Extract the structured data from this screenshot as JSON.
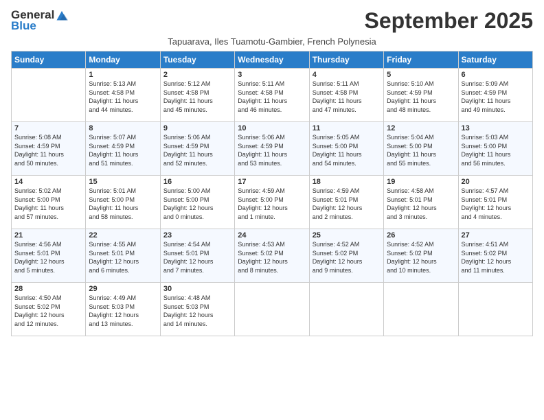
{
  "logo": {
    "general": "General",
    "blue": "Blue"
  },
  "header": {
    "month_title": "September 2025",
    "subtitle": "Tapuarava, Iles Tuamotu-Gambier, French Polynesia"
  },
  "days_of_week": [
    "Sunday",
    "Monday",
    "Tuesday",
    "Wednesday",
    "Thursday",
    "Friday",
    "Saturday"
  ],
  "weeks": [
    [
      {
        "day": "",
        "content": ""
      },
      {
        "day": "1",
        "content": "Sunrise: 5:13 AM\nSunset: 4:58 PM\nDaylight: 11 hours\nand 44 minutes."
      },
      {
        "day": "2",
        "content": "Sunrise: 5:12 AM\nSunset: 4:58 PM\nDaylight: 11 hours\nand 45 minutes."
      },
      {
        "day": "3",
        "content": "Sunrise: 5:11 AM\nSunset: 4:58 PM\nDaylight: 11 hours\nand 46 minutes."
      },
      {
        "day": "4",
        "content": "Sunrise: 5:11 AM\nSunset: 4:58 PM\nDaylight: 11 hours\nand 47 minutes."
      },
      {
        "day": "5",
        "content": "Sunrise: 5:10 AM\nSunset: 4:59 PM\nDaylight: 11 hours\nand 48 minutes."
      },
      {
        "day": "6",
        "content": "Sunrise: 5:09 AM\nSunset: 4:59 PM\nDaylight: 11 hours\nand 49 minutes."
      }
    ],
    [
      {
        "day": "7",
        "content": "Sunrise: 5:08 AM\nSunset: 4:59 PM\nDaylight: 11 hours\nand 50 minutes."
      },
      {
        "day": "8",
        "content": "Sunrise: 5:07 AM\nSunset: 4:59 PM\nDaylight: 11 hours\nand 51 minutes."
      },
      {
        "day": "9",
        "content": "Sunrise: 5:06 AM\nSunset: 4:59 PM\nDaylight: 11 hours\nand 52 minutes."
      },
      {
        "day": "10",
        "content": "Sunrise: 5:06 AM\nSunset: 4:59 PM\nDaylight: 11 hours\nand 53 minutes."
      },
      {
        "day": "11",
        "content": "Sunrise: 5:05 AM\nSunset: 5:00 PM\nDaylight: 11 hours\nand 54 minutes."
      },
      {
        "day": "12",
        "content": "Sunrise: 5:04 AM\nSunset: 5:00 PM\nDaylight: 11 hours\nand 55 minutes."
      },
      {
        "day": "13",
        "content": "Sunrise: 5:03 AM\nSunset: 5:00 PM\nDaylight: 11 hours\nand 56 minutes."
      }
    ],
    [
      {
        "day": "14",
        "content": "Sunrise: 5:02 AM\nSunset: 5:00 PM\nDaylight: 11 hours\nand 57 minutes."
      },
      {
        "day": "15",
        "content": "Sunrise: 5:01 AM\nSunset: 5:00 PM\nDaylight: 11 hours\nand 58 minutes."
      },
      {
        "day": "16",
        "content": "Sunrise: 5:00 AM\nSunset: 5:00 PM\nDaylight: 12 hours\nand 0 minutes."
      },
      {
        "day": "17",
        "content": "Sunrise: 4:59 AM\nSunset: 5:00 PM\nDaylight: 12 hours\nand 1 minute."
      },
      {
        "day": "18",
        "content": "Sunrise: 4:59 AM\nSunset: 5:01 PM\nDaylight: 12 hours\nand 2 minutes."
      },
      {
        "day": "19",
        "content": "Sunrise: 4:58 AM\nSunset: 5:01 PM\nDaylight: 12 hours\nand 3 minutes."
      },
      {
        "day": "20",
        "content": "Sunrise: 4:57 AM\nSunset: 5:01 PM\nDaylight: 12 hours\nand 4 minutes."
      }
    ],
    [
      {
        "day": "21",
        "content": "Sunrise: 4:56 AM\nSunset: 5:01 PM\nDaylight: 12 hours\nand 5 minutes."
      },
      {
        "day": "22",
        "content": "Sunrise: 4:55 AM\nSunset: 5:01 PM\nDaylight: 12 hours\nand 6 minutes."
      },
      {
        "day": "23",
        "content": "Sunrise: 4:54 AM\nSunset: 5:01 PM\nDaylight: 12 hours\nand 7 minutes."
      },
      {
        "day": "24",
        "content": "Sunrise: 4:53 AM\nSunset: 5:02 PM\nDaylight: 12 hours\nand 8 minutes."
      },
      {
        "day": "25",
        "content": "Sunrise: 4:52 AM\nSunset: 5:02 PM\nDaylight: 12 hours\nand 9 minutes."
      },
      {
        "day": "26",
        "content": "Sunrise: 4:52 AM\nSunset: 5:02 PM\nDaylight: 12 hours\nand 10 minutes."
      },
      {
        "day": "27",
        "content": "Sunrise: 4:51 AM\nSunset: 5:02 PM\nDaylight: 12 hours\nand 11 minutes."
      }
    ],
    [
      {
        "day": "28",
        "content": "Sunrise: 4:50 AM\nSunset: 5:02 PM\nDaylight: 12 hours\nand 12 minutes."
      },
      {
        "day": "29",
        "content": "Sunrise: 4:49 AM\nSunset: 5:03 PM\nDaylight: 12 hours\nand 13 minutes."
      },
      {
        "day": "30",
        "content": "Sunrise: 4:48 AM\nSunset: 5:03 PM\nDaylight: 12 hours\nand 14 minutes."
      },
      {
        "day": "",
        "content": ""
      },
      {
        "day": "",
        "content": ""
      },
      {
        "day": "",
        "content": ""
      },
      {
        "day": "",
        "content": ""
      }
    ]
  ]
}
